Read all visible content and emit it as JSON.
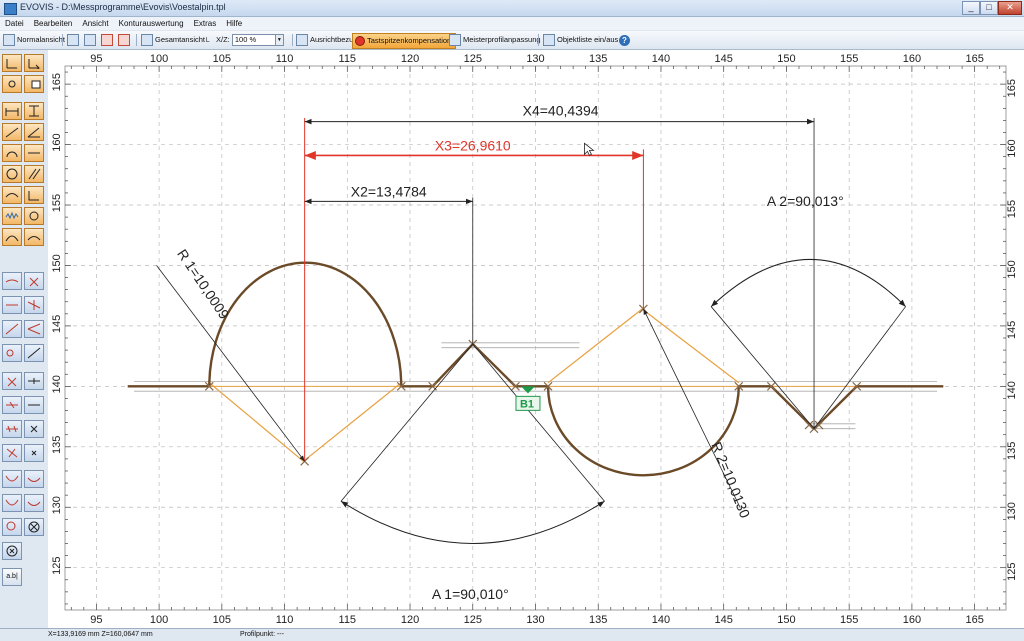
{
  "window": {
    "title": "EVOVIS - D:\\Messprogramme\\Evovis\\Voestalpin.tpl",
    "minimize": "_",
    "maximize": "□",
    "close": "✕"
  },
  "menu": [
    "Datei",
    "Bearbeiten",
    "Ansicht",
    "Konturauswertung",
    "Extras",
    "Hilfe"
  ],
  "toolbar": {
    "normal_view": "Normalansicht",
    "overall_view": "Gesamtansicht",
    "xz_label": "X/Z:",
    "zoom_value": "100 %",
    "alignment": "Ausrichtbezug",
    "probe_compensation": "Tastspitzenkompensation",
    "master_profile": "Meisterprofilanpassung",
    "objects_toggle": "Objektliste ein/aus",
    "help": "?"
  },
  "sidebar": {
    "text_tool": "a.b|"
  },
  "axes": {
    "x_ticks": [
      "95",
      "100",
      "105",
      "110",
      "115",
      "120",
      "125",
      "130",
      "135",
      "140",
      "145",
      "150",
      "155",
      "160",
      "165"
    ],
    "y_ticks": [
      "165",
      "160",
      "155",
      "150",
      "145",
      "140",
      "135",
      "130",
      "125"
    ],
    "x_min": 92.5,
    "x_max": 167.5,
    "y_min": 121.5,
    "y_max": 166.5
  },
  "annotations": {
    "x4": "X4=40,4394",
    "x3": "X3=26,9610",
    "x2": "X2=13,4784",
    "a2": "A 2=90,013°",
    "r1": "R 1=10,0009",
    "r2": "R 2=10,0130",
    "a1": "A 1=90,010°",
    "b1": "B1"
  },
  "colors": {
    "profile": "#6b4a28",
    "construction": "#e8a040",
    "dimension_active": "#e0362a",
    "dimension": "#222222",
    "marker": "#1e9a4a"
  },
  "status": {
    "coords": "X=133,9169 mm Z=160,0647 mm",
    "profile_point": "Profilpunkt: ---"
  }
}
